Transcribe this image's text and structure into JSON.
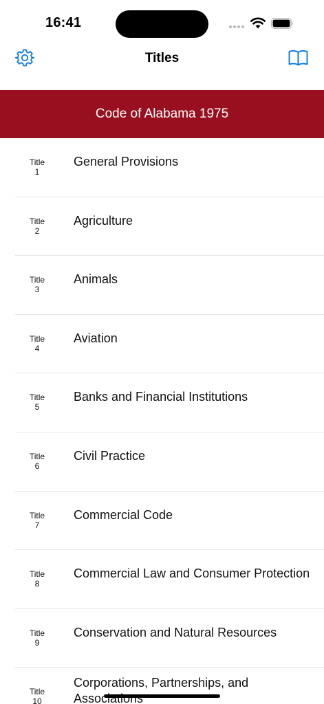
{
  "status_bar": {
    "time": "16:41"
  },
  "nav": {
    "title": "Titles",
    "settings_icon": "gear-icon",
    "library_icon": "book-icon"
  },
  "banner": {
    "text": "Code of Alabama 1975",
    "color": "#98101f"
  },
  "titles": [
    {
      "label": "Title",
      "number": "1",
      "name": "General Provisions"
    },
    {
      "label": "Title",
      "number": "2",
      "name": "Agriculture"
    },
    {
      "label": "Title",
      "number": "3",
      "name": "Animals"
    },
    {
      "label": "Title",
      "number": "4",
      "name": "Aviation"
    },
    {
      "label": "Title",
      "number": "5",
      "name": "Banks and Financial Institutions"
    },
    {
      "label": "Title",
      "number": "6",
      "name": "Civil Practice"
    },
    {
      "label": "Title",
      "number": "7",
      "name": "Commercial Code"
    },
    {
      "label": "Title",
      "number": "8",
      "name": "Commercial Law and Consumer Protection"
    },
    {
      "label": "Title",
      "number": "9",
      "name": "Conservation and Natural Resources"
    },
    {
      "label": "Title",
      "number": "10",
      "name": "Corporations, Partnerships, and Associations"
    }
  ],
  "colors": {
    "accent": "#0a7ae2",
    "banner": "#98101f"
  }
}
